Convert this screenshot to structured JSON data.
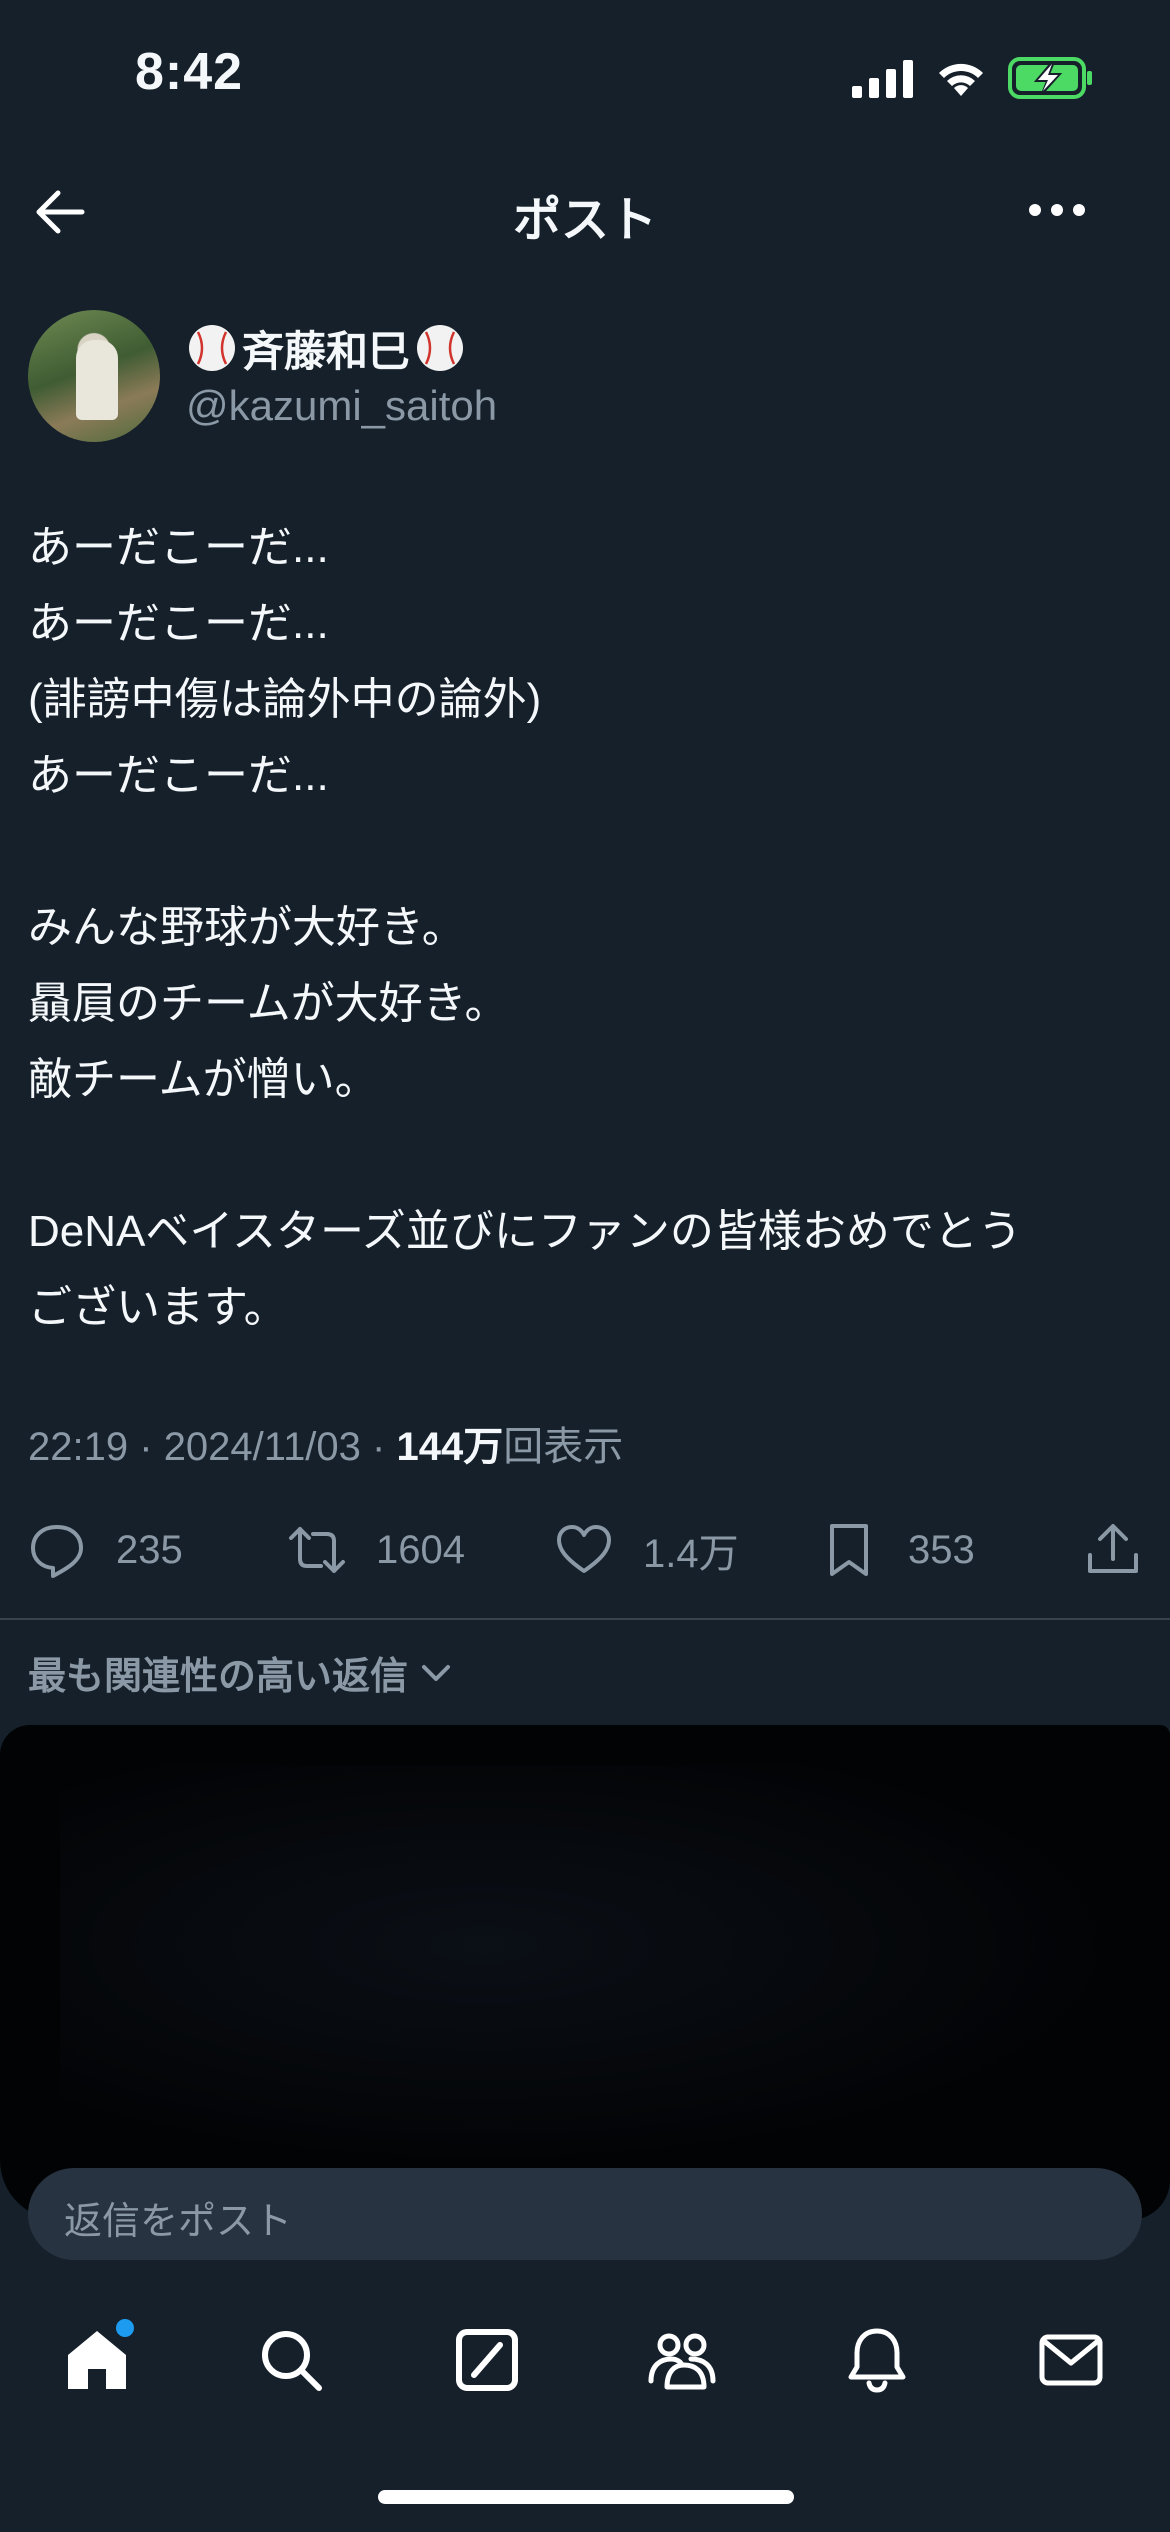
{
  "status_bar": {
    "time": "8:42",
    "icons": [
      "signal-icon",
      "wifi-icon",
      "battery-charging-icon"
    ],
    "battery_color": "#4cd964"
  },
  "nav": {
    "title": "ポスト",
    "back_icon": "arrow-left-icon",
    "more_icon": "more-horizontal-icon"
  },
  "author": {
    "name": "斉藤和巳",
    "handle": "@kazumi_saitoh",
    "name_decoration_icon": "baseball-icon"
  },
  "post": {
    "lines": [
      "あーだこーだ...",
      "あーだこーだ...",
      "(誹謗中傷は論外中の論外)",
      "あーだこーだ...",
      "",
      "みんな野球が大好き。",
      "贔屓のチームが大好き。",
      "敵チームが憎い。",
      "",
      "DeNAベイスターズ並びにファンの皆様おめでとう",
      "ございます。"
    ],
    "time": "22:19",
    "separator": "·",
    "date": "2024/11/03",
    "views_count": "144万",
    "views_label": "回表示"
  },
  "actions": {
    "replies": "235",
    "reposts": "1604",
    "likes": "1.4万",
    "bookmarks": "353"
  },
  "replies": {
    "sort_label": "最も関連性の高い返信",
    "input_placeholder": "返信をポスト"
  },
  "tab_bar": {
    "tabs": [
      "home-icon",
      "search-icon",
      "grok-icon",
      "communities-icon",
      "notifications-icon",
      "messages-icon"
    ],
    "accent": "#1d9bf0"
  },
  "colors": {
    "background": "#15202b",
    "text": "#f5f8fa",
    "secondary_text": "#8b98a5",
    "divider": "#38444d"
  }
}
